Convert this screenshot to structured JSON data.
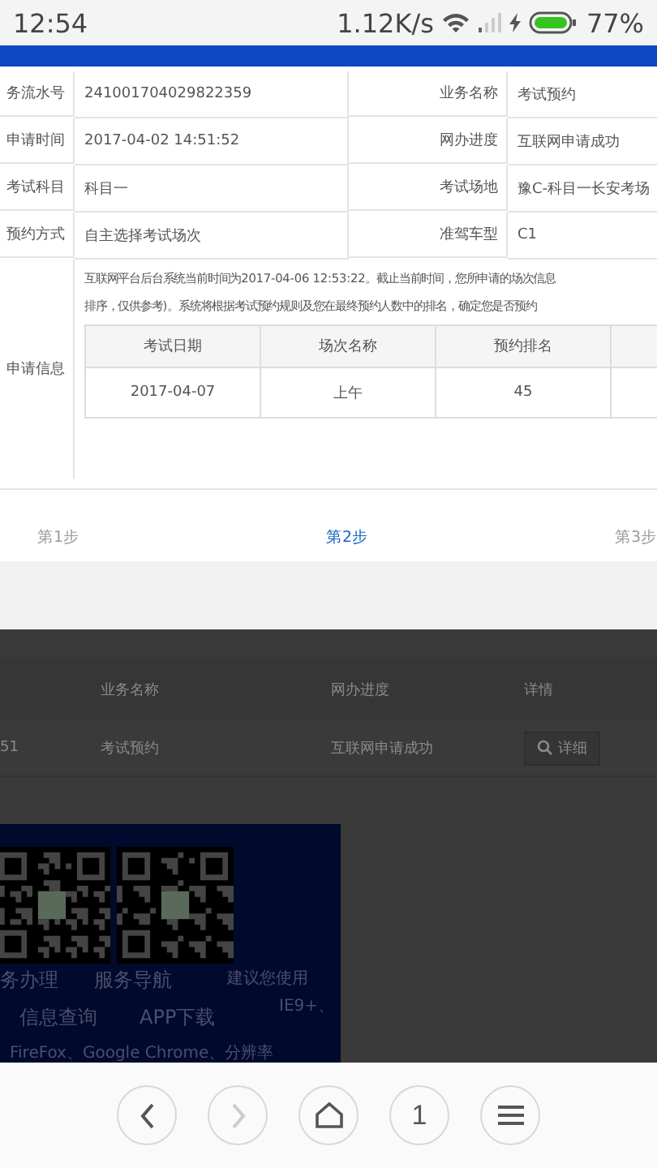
{
  "status_bar": {
    "time": "12:54",
    "speed": "1.12K/s",
    "battery": "77%"
  },
  "details": {
    "rows": [
      {
        "label": "务流水号",
        "value": "241001704029822359",
        "label2": "业务名称",
        "value2": "考试预约"
      },
      {
        "label": "申请时间",
        "value": "2017-04-02 14:51:52",
        "label2": "网办进度",
        "value2": "互联网申请成功"
      },
      {
        "label": "考试科目",
        "value": "科目一",
        "label2": "考试场地",
        "value2": "豫C-科目一长安考场"
      },
      {
        "label": "预约方式",
        "value": "自主选择考试场次",
        "label2": "准驾车型",
        "value2": "C1"
      }
    ],
    "info": {
      "label": "申请信息",
      "lines": [
        "互联网平台后台系统当前时间为2017-04-06 12:53:22。截止当前时间，您所申请的场次信息",
        "排序，仅供参考)。系统将根据考试预约规则及您在最终预约人数中的排名，确定您是否预约"
      ],
      "table": {
        "columns": [
          "考试日期",
          "场次名称",
          "预约排名",
          ""
        ],
        "rows": [
          [
            "2017-04-07",
            "上午",
            "45",
            ""
          ]
        ]
      }
    }
  },
  "steps": [
    {
      "label": "第1步",
      "selected": false
    },
    {
      "label": "第2步",
      "selected": true
    },
    {
      "label": "第3步",
      "selected": false
    }
  ],
  "background_page": {
    "columns": [
      "业务名称",
      "网办进度",
      "详情"
    ],
    "row": {
      "cut_cell": "51",
      "name": "考试预约",
      "progress": "互联网申请成功",
      "button": "详细"
    },
    "footer": {
      "links": [
        "务办理",
        "服务导航",
        "信息查询",
        "APP下载"
      ],
      "notes": [
        "建议您使用",
        "IE9+、",
        "FireFox、Google Chrome、分辨率"
      ]
    }
  },
  "nav": [
    {
      "kind": "back",
      "disabled": false
    },
    {
      "kind": "forward",
      "disabled": true
    },
    {
      "kind": "home",
      "disabled": false
    },
    {
      "kind": "tabs",
      "label": "1",
      "disabled": false
    },
    {
      "kind": "menu",
      "disabled": false
    }
  ]
}
